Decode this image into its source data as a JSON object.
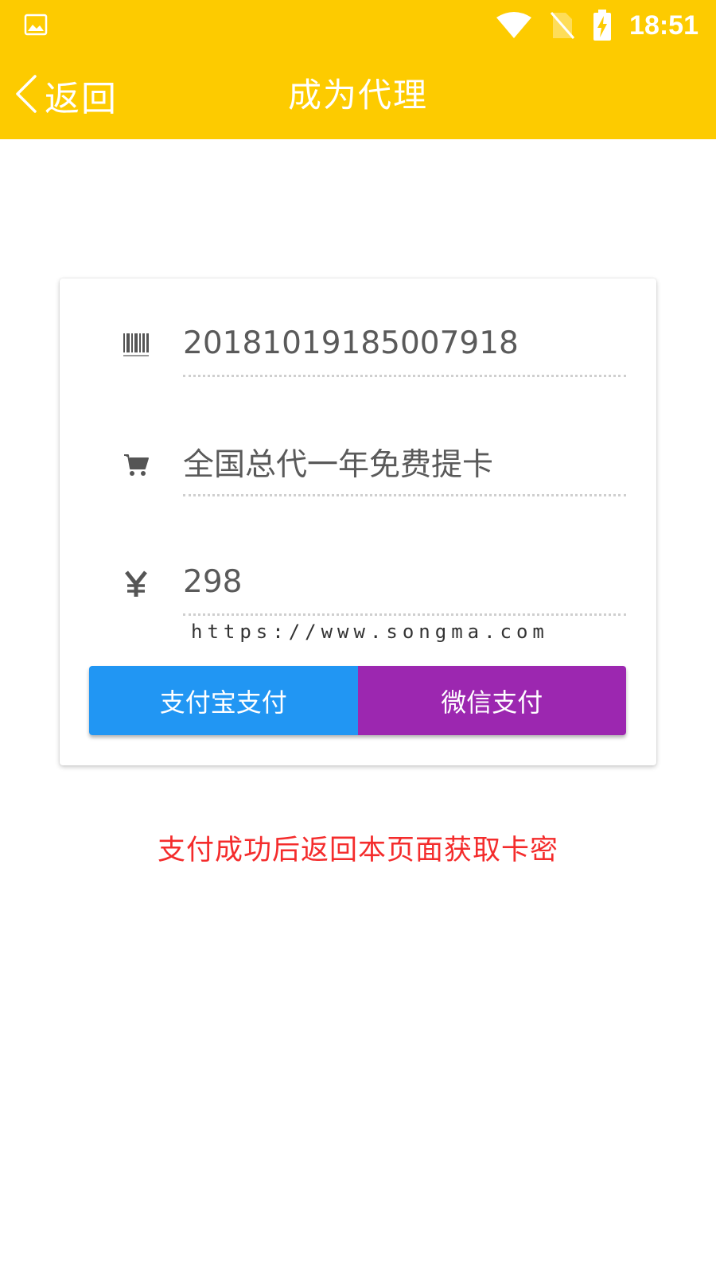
{
  "status_bar": {
    "time": "18:51",
    "icons": [
      "image-icon",
      "wifi-icon",
      "no-sim-icon",
      "battery-charging-icon"
    ]
  },
  "toolbar": {
    "back_label": "返回",
    "title": "成为代理"
  },
  "form": {
    "order_number": "20181019185007918",
    "product_name": "全国总代一年免费提卡",
    "price": "298",
    "icons": [
      "barcode-icon",
      "cart-icon",
      "yen-icon"
    ]
  },
  "watermark": "https://www.songma.com",
  "payment": {
    "alipay_label": "支付宝支付",
    "wechat_label": "微信支付"
  },
  "notice": "支付成功后返回本页面获取卡密",
  "colors": {
    "toolbar": "#FDCB00",
    "alipay": "#2196F3",
    "wechat": "#9C27B0",
    "notice": "#F42C2C"
  }
}
